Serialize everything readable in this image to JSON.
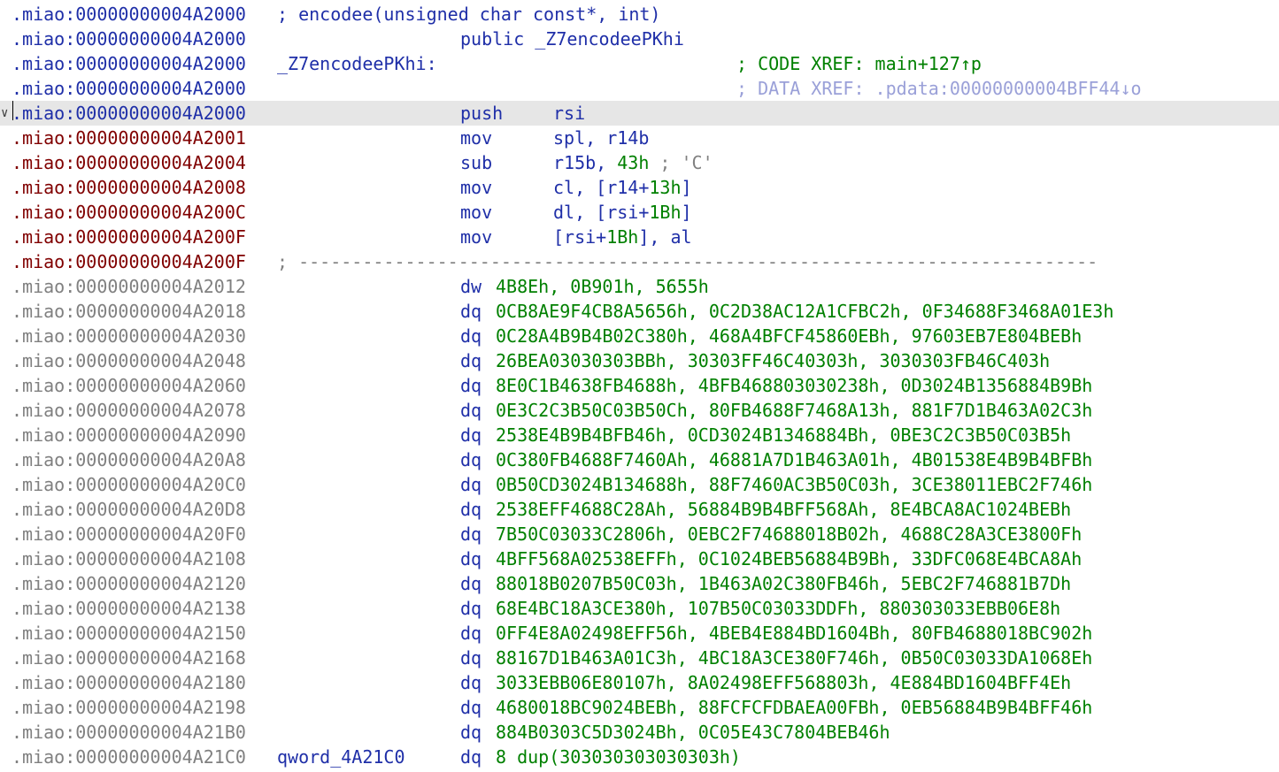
{
  "colors": {
    "address_code_header": "#1f2fa8",
    "address_code": "#800000",
    "address_data": "#808080",
    "keyword": "#1f2fa8",
    "number": "#008000",
    "comment": "#808080",
    "highlight_row": "#e6e6e6"
  },
  "header": {
    "addr": ".miao:00000000004A2000",
    "signature_comment": "; encodee(unsigned char const*, int)",
    "public_decl": "public _Z7encodeePKhi",
    "func_label": "_Z7encodeePKhi:",
    "code_xref": "; CODE XREF: main+127↑p",
    "data_xref": "; DATA XREF: .pdata:00000000004BFF44↓o"
  },
  "fold_icon": "chevron-down-icon",
  "instructions": [
    {
      "addr": ".miao:00000000004A2000",
      "mnem": "push",
      "ops": [
        [
          "r",
          "rsi"
        ]
      ]
    },
    {
      "addr": ".miao:00000000004A2001",
      "mnem": "mov",
      "ops": [
        [
          "r",
          "spl, r14b"
        ]
      ]
    },
    {
      "addr": ".miao:00000000004A2004",
      "mnem": "sub",
      "ops": [
        [
          "r",
          "r15b, "
        ],
        [
          "n",
          "43h"
        ],
        [
          "g",
          " ; 'C'"
        ]
      ]
    },
    {
      "addr": ".miao:00000000004A2008",
      "mnem": "mov",
      "ops": [
        [
          "r",
          "cl, [r14+"
        ],
        [
          "n",
          "13h"
        ],
        [
          "r",
          "]"
        ]
      ]
    },
    {
      "addr": ".miao:00000000004A200C",
      "mnem": "mov",
      "ops": [
        [
          "r",
          "dl, [rsi+"
        ],
        [
          "n",
          "1Bh"
        ],
        [
          "r",
          "]"
        ]
      ]
    },
    {
      "addr": ".miao:00000000004A200F",
      "mnem": "mov",
      "ops": [
        [
          "r",
          "[rsi+"
        ],
        [
          "n",
          "1Bh"
        ],
        [
          "r",
          "], al"
        ]
      ]
    }
  ],
  "separator": {
    "addr": ".miao:00000000004A200F",
    "text": "; ---------------------------------------------------------------------------"
  },
  "data_lines": [
    {
      "addr": ".miao:00000000004A2012",
      "label": "",
      "dir": "dw",
      "values": "4B8Eh, 0B901h, 5655h"
    },
    {
      "addr": ".miao:00000000004A2018",
      "label": "",
      "dir": "dq",
      "values": "0CB8AE9F4CB8A5656h, 0C2D38AC12A1CFBC2h, 0F34688F3468A01E3h"
    },
    {
      "addr": ".miao:00000000004A2030",
      "label": "",
      "dir": "dq",
      "values": "0C28A4B9B4B02C380h, 468A4BFCF45860EBh, 97603EB7E804BEBh"
    },
    {
      "addr": ".miao:00000000004A2048",
      "label": "",
      "dir": "dq",
      "values": "26BEA03030303BBh, 30303FF46C40303h, 3030303FB46C403h"
    },
    {
      "addr": ".miao:00000000004A2060",
      "label": "",
      "dir": "dq",
      "values": "8E0C1B4638FB4688h, 4BFB468803030238h, 0D3024B1356884B9Bh"
    },
    {
      "addr": ".miao:00000000004A2078",
      "label": "",
      "dir": "dq",
      "values": "0E3C2C3B50C03B50Ch, 80FB4688F7468A13h, 881F7D1B463A02C3h"
    },
    {
      "addr": ".miao:00000000004A2090",
      "label": "",
      "dir": "dq",
      "values": "2538E4B9B4BFB46h, 0CD3024B1346884Bh, 0BE3C2C3B50C03B5h"
    },
    {
      "addr": ".miao:00000000004A20A8",
      "label": "",
      "dir": "dq",
      "values": "0C380FB4688F7460Ah, 46881A7D1B463A01h, 4B01538E4B9B4BFBh"
    },
    {
      "addr": ".miao:00000000004A20C0",
      "label": "",
      "dir": "dq",
      "values": "0B50CD3024B134688h, 88F7460AC3B50C03h, 3CE38011EBC2F746h"
    },
    {
      "addr": ".miao:00000000004A20D8",
      "label": "",
      "dir": "dq",
      "values": "2538EFF4688C28Ah, 56884B9B4BFF568Ah, 8E4BCA8AC1024BEBh"
    },
    {
      "addr": ".miao:00000000004A20F0",
      "label": "",
      "dir": "dq",
      "values": "7B50C03033C2806h, 0EBC2F74688018B02h, 4688C28A3CE3800Fh"
    },
    {
      "addr": ".miao:00000000004A2108",
      "label": "",
      "dir": "dq",
      "values": "4BFF568A02538EFFh, 0C1024BEB56884B9Bh, 33DFC068E4BCA8Ah"
    },
    {
      "addr": ".miao:00000000004A2120",
      "label": "",
      "dir": "dq",
      "values": "88018B0207B50C03h, 1B463A02C380FB46h, 5EBC2F746881B7Dh"
    },
    {
      "addr": ".miao:00000000004A2138",
      "label": "",
      "dir": "dq",
      "values": "68E4BC18A3CE380h, 107B50C03033DDFh, 880303033EBB06E8h"
    },
    {
      "addr": ".miao:00000000004A2150",
      "label": "",
      "dir": "dq",
      "values": "0FF4E8A02498EFF56h, 4BEB4E884BD1604Bh, 80FB4688018BC902h"
    },
    {
      "addr": ".miao:00000000004A2168",
      "label": "",
      "dir": "dq",
      "values": "88167D1B463A01C3h, 4BC18A3CE380F746h, 0B50C03033DA1068Eh"
    },
    {
      "addr": ".miao:00000000004A2180",
      "label": "",
      "dir": "dq",
      "values": "3033EBB06E80107h, 8A02498EFF568803h, 4E884BD1604BFF4Eh"
    },
    {
      "addr": ".miao:00000000004A2198",
      "label": "",
      "dir": "dq",
      "values": "4680018BC9024BEBh, 88FCFCFDBAEA00FBh, 0EB56884B9B4BFF46h"
    },
    {
      "addr": ".miao:00000000004A21B0",
      "label": "",
      "dir": "dq",
      "values": "884B0303C5D3024Bh, 0C05E43C7804BEB46h"
    },
    {
      "addr": ".miao:00000000004A21C0",
      "label": "qword_4A21C0",
      "dir": "dq",
      "values": "8 dup(303030303030303h)"
    }
  ]
}
